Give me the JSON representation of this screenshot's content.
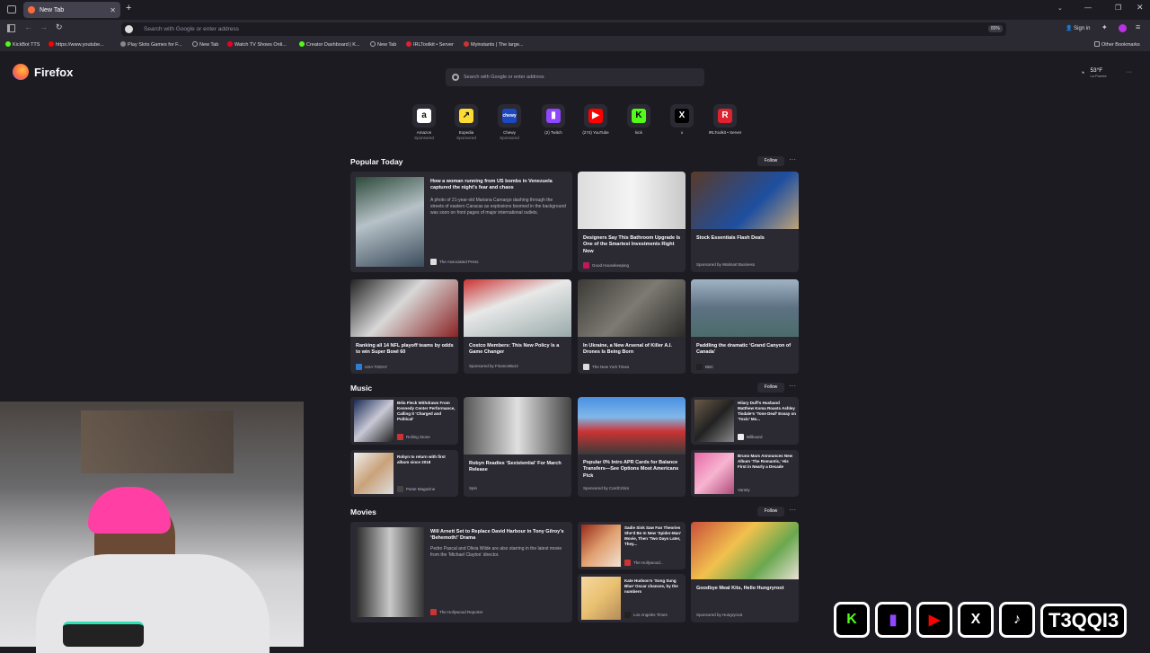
{
  "browser": {
    "tab_title": "New Tab",
    "url_placeholder": "Search with Google or enter address",
    "zoom": "80%",
    "sign_in": "Sign in",
    "other_bookmarks": "Other Bookmarks"
  },
  "bookmarks": [
    "KickBot TTS",
    "https://www.youtube...",
    "Play Slots Games for F...",
    "New Tab",
    "Watch TV Shows Onli...",
    "Creator Dashboard | K...",
    "New Tab",
    "IRLToolkit • Server",
    "Myinstants | The large..."
  ],
  "brand": "Firefox",
  "weather": {
    "temp": "53°F",
    "place": "La Puente"
  },
  "search_placeholder": "Search with Google or enter address",
  "shortcuts": [
    {
      "label": "Amazon",
      "sub": "Sponsored",
      "glyph": "a",
      "color": "#ffffff",
      "fg": "#111"
    },
    {
      "label": "Expedia",
      "sub": "Sponsored",
      "glyph": "↗",
      "color": "#fddb32",
      "fg": "#111"
    },
    {
      "label": "Chewy",
      "sub": "Sponsored",
      "glyph": "chewy",
      "color": "#1c49c2",
      "fg": "#fff"
    },
    {
      "label": "(2) Twitch",
      "sub": "",
      "glyph": "▮",
      "color": "#9146ff",
      "fg": "#fff"
    },
    {
      "label": "(274) YouTube",
      "sub": "",
      "glyph": "▶",
      "color": "#ff0000",
      "fg": "#fff"
    },
    {
      "label": "kick",
      "sub": "",
      "glyph": "K",
      "color": "#53fc18",
      "fg": "#000"
    },
    {
      "label": "x",
      "sub": "",
      "glyph": "X",
      "color": "#000000",
      "fg": "#fff"
    },
    {
      "label": "IRLToolkit • Server",
      "sub": "",
      "glyph": "R",
      "color": "#e0222e",
      "fg": "#fff"
    }
  ],
  "sections": {
    "popular": "Popular Today",
    "music": "Music",
    "movies": "Movies",
    "follow": "Follow",
    "more": "···"
  },
  "popular_cards": [
    {
      "title": "How a woman running from US bombs in Venezuela captured the night’s fear and chaos",
      "desc": "A photo of 21-year-old Mariana Camargo dashing through the streets of eastern Caracas as explosions boomed in the background was soon on front pages of major international outlets.",
      "source": "The Associated Press"
    },
    {
      "title": "Designers Say This Bathroom Upgrade Is One of the Smartest Investments Right Now",
      "source": "Good Housekeeping"
    },
    {
      "title": "Stock Essentials Flash Deals",
      "source": "Sponsored by Walmart Business"
    },
    {
      "title": "Ranking all 14 NFL playoff teams by odds to win Super Bowl 60",
      "source": "USA TODAY"
    },
    {
      "title": "Costco Members: This New Policy Is a Game Changer",
      "source": "Sponsored by FinanceBuzz"
    },
    {
      "title": "In Ukraine, a New Arsenal of Killer A.I. Drones Is Being Born",
      "source": "The New York Times"
    },
    {
      "title": "Paddling the dramatic ‘Grand Canyon of Canada’",
      "source": "BBC"
    }
  ],
  "music_cards": [
    {
      "title": "Béla Fleck Withdraws From Kennedy Center Performance, Calling It ‘Charged and Political’",
      "source": "Rolling Stone"
    },
    {
      "title": "Robyn Readies ‘Sexistential’ For March Release",
      "source": "Spin"
    },
    {
      "title": "Popular 0% Intro APR Cards for Balance Transfers—See Options Most Americans Pick",
      "source": "Sponsored by CardCritics"
    },
    {
      "title": "Hilary Duff’s Husband Matthew Koma Roasts Ashley Tisdale’s ‘Tone Deaf’ Essay on ‘Toxic’ Mo...",
      "source": "Billboard"
    },
    {
      "title": "Robyn to return with first album since 2018",
      "source": "Paste Magazine"
    },
    {
      "title": "Bruno Mars Announces New Album ‘The Romantic,’ His First in Nearly a Decade",
      "source": "Variety"
    }
  ],
  "movie_cards": [
    {
      "title": "Will Arnett Set to Replace David Harbour in Tony Gilroy’s ‘Behemoth!’ Drama",
      "desc": "Pedro Pascal and Olivia Wilde are also starring in the latest movie from the ‘Michael Clayton’ director.",
      "source": "The Hollywood Reporter"
    },
    {
      "title": "Sadie Sink Saw Fan Theories She’d Be In New ‘Spider-Man’ Movie, Then ‘Two Days Later, They...",
      "source": "The Hollywood..."
    },
    {
      "title": "Kate Hudson’s ‘Song Sung Blue’ Oscar chances, by the numbers",
      "source": "Los Angeles Times"
    },
    {
      "title": "Goodbye Meal Kits, Hello Hungryroot",
      "source": "Sponsored by Hungryroot"
    }
  ],
  "overlay": {
    "handle": "T3QQI3"
  }
}
